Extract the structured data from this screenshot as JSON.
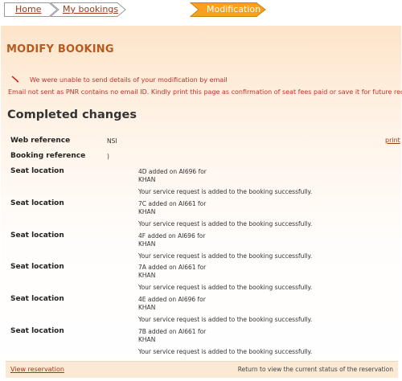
{
  "breadcrumb": {
    "home": "Home",
    "my_bookings": "My bookings",
    "current": "Modification",
    "accent": "#f7a11d"
  },
  "page_title": "MODIFY BOOKING",
  "errors": {
    "icon": "error-pencil-icon",
    "line1": "We were unable to send details of your modification by email",
    "line2": "Email not sent as PNR contains no email ID. Kindly print this page as confirmation of seat fees paid or save it for future records."
  },
  "section_title": "Completed changes",
  "web_reference": {
    "label": "Web reference",
    "value": "NSI"
  },
  "booking_reference": {
    "label": "Booking reference",
    "value": ")"
  },
  "print_label": "print",
  "seats": [
    {
      "label": "Seat location",
      "line1": "4D added on AI696 for",
      "line2": "KHAN",
      "status": "Your service request is added to the booking successfully."
    },
    {
      "label": "Seat location",
      "line1": "7C added on AI661 for",
      "line2": "KHAN",
      "status": "Your service request is added to the booking successfully."
    },
    {
      "label": "Seat location",
      "line1": "4F added on AI696 for",
      "line2": "KHAN",
      "status": "Your service request is added to the booking successfully."
    },
    {
      "label": "Seat location",
      "line1": "7A added on AI661 for",
      "line2": "KHAN",
      "status": "Your service request is added to the booking successfully."
    },
    {
      "label": "Seat location",
      "line1": "4E added on AI696 for",
      "line2": "KHAN",
      "status": "Your service request is added to the booking successfully."
    },
    {
      "label": "Seat location",
      "line1": "7B added on AI661 for",
      "line2": "KHAN",
      "status": "Your service request is added to the booking successfully."
    }
  ],
  "footer": {
    "link": "View reservation",
    "note": "Return to view the current status of the reservation"
  }
}
